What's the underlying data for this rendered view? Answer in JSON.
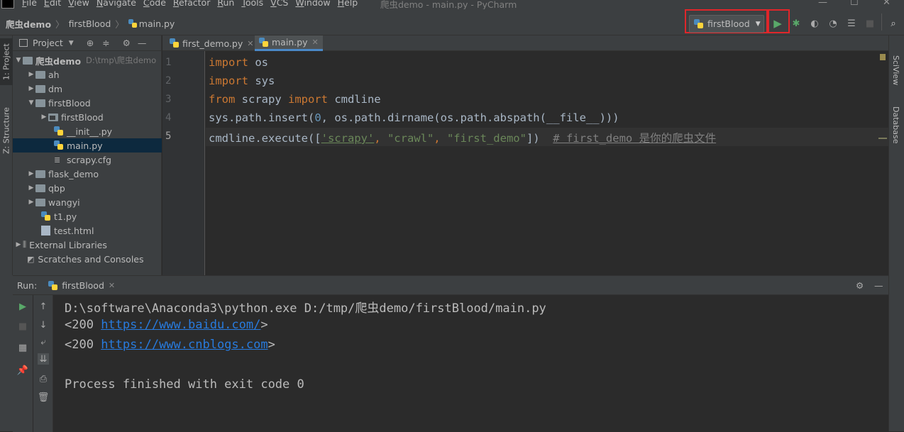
{
  "window": {
    "title": "爬虫demo - main.py - PyCharm",
    "menu": [
      "File",
      "Edit",
      "View",
      "Navigate",
      "Code",
      "Refactor",
      "Run",
      "Tools",
      "VCS",
      "Window",
      "Help"
    ]
  },
  "breadcrumb": [
    "爬虫demo",
    "firstBlood",
    "main.py"
  ],
  "toolbar": {
    "run_config": "firstBlood",
    "icons": [
      "run-icon",
      "debug-icon",
      "coverage-icon",
      "profile-icon",
      "run-concurrency-icon",
      "stop-icon",
      "search-icon"
    ]
  },
  "left_tabs": {
    "project": "1: Project",
    "structure": "Z: Structure"
  },
  "right_tabs": {
    "sciview": "SciView",
    "database": "Database"
  },
  "project_panel": {
    "title": "Project",
    "tree": [
      {
        "label": "爬虫demo",
        "suffix": "D:\\tmp\\爬虫demo",
        "type": "folder",
        "expanded": true,
        "depth": 0
      },
      {
        "label": "ah",
        "type": "folder",
        "expanded": false,
        "depth": 1
      },
      {
        "label": "dm",
        "type": "folder",
        "expanded": false,
        "depth": 1
      },
      {
        "label": "firstBlood",
        "type": "folder",
        "expanded": true,
        "depth": 1
      },
      {
        "label": "firstBlood",
        "type": "module",
        "expanded": false,
        "depth": 2
      },
      {
        "label": "__init__.py",
        "type": "py",
        "depth": 2
      },
      {
        "label": "main.py",
        "type": "py",
        "depth": 2,
        "selected": true
      },
      {
        "label": "scrapy.cfg",
        "type": "cfg",
        "depth": 2
      },
      {
        "label": "flask_demo",
        "type": "folder",
        "expanded": false,
        "depth": 1
      },
      {
        "label": "qbp",
        "type": "folder",
        "expanded": false,
        "depth": 1
      },
      {
        "label": "wangyi",
        "type": "folder",
        "expanded": false,
        "depth": 1
      },
      {
        "label": "t1.py",
        "type": "py",
        "depth": 1
      },
      {
        "label": "test.html",
        "type": "html",
        "depth": 1
      },
      {
        "label": "External Libraries",
        "type": "lib",
        "depth": 0
      },
      {
        "label": "Scratches and Consoles",
        "type": "scratch",
        "depth": 0
      }
    ]
  },
  "editor": {
    "tabs": [
      {
        "label": "first_demo.py",
        "active": false
      },
      {
        "label": "main.py",
        "active": true
      }
    ],
    "line_numbers": [
      "1",
      "2",
      "3",
      "4",
      "5"
    ],
    "lines": {
      "l1_kw": "import",
      "l1_rest": " os",
      "l2_kw": "import",
      "l2_rest": " sys",
      "l3_kw1": "from",
      "l3_mid": " scrapy ",
      "l3_kw2": "import",
      "l3_rest": " cmdline",
      "l4_a": "sys.path.insert(",
      "l4_num": "0",
      "l4_b": ", os.path.dirname(os.path.abspath(__file__)))",
      "l5_a": "cmdline.execute([",
      "l5_s1": "'scrapy'",
      "l5_c1": ", ",
      "l5_s2": "\"crawl\"",
      "l5_c2": ", ",
      "l5_s3": "\"first_demo\"",
      "l5_b": "])  ",
      "l5_cmt": "# first_demo 是你的爬虫文件"
    }
  },
  "run_panel": {
    "label": "Run:",
    "tab": "firstBlood",
    "output": {
      "cmd": "D:\\software\\Anaconda3\\python.exe D:/tmp/爬虫demo/firstBlood/main.py",
      "r1_pre": "<200 ",
      "r1_link": "https://www.baidu.com/",
      "r1_post": ">",
      "r2_pre": "<200 ",
      "r2_link": "https://www.cnblogs.com",
      "r2_post": ">",
      "exit": "Process finished with exit code 0"
    }
  },
  "colors": {
    "highlight_box": "#e0262a",
    "run_green": "#59a869",
    "link": "#287bde"
  }
}
